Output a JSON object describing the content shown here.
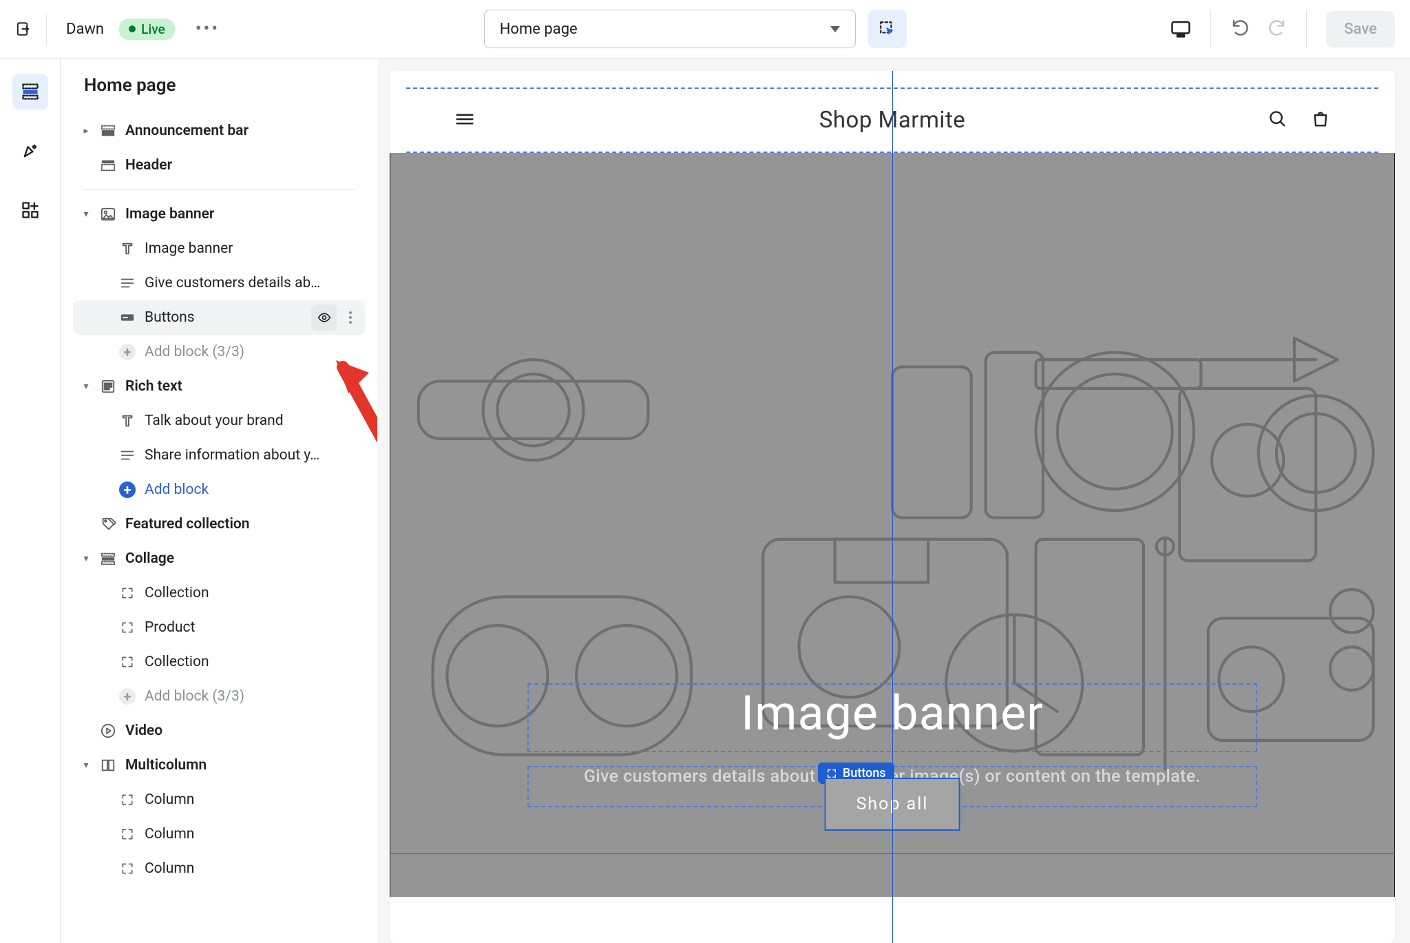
{
  "topbar": {
    "theme_name": "Dawn",
    "status_badge": "Live",
    "page_selector": "Home page",
    "save_label": "Save"
  },
  "tree": {
    "title": "Home page",
    "announcement_bar": "Announcement bar",
    "header": "Header",
    "image_banner": {
      "label": "Image banner",
      "child_heading": "Image banner",
      "child_text": "Give customers details ab…",
      "child_buttons": "Buttons",
      "add_block": "Add block (3/3)"
    },
    "rich_text": {
      "label": "Rich text",
      "child_heading": "Talk about your brand",
      "child_text": "Share information about y…",
      "add_block": "Add block"
    },
    "featured_collection": "Featured collection",
    "collage": {
      "label": "Collage",
      "items": [
        "Collection",
        "Product",
        "Collection"
      ],
      "add_block": "Add block (3/3)"
    },
    "video": "Video",
    "multicolumn": {
      "label": "Multicolumn",
      "items": [
        "Column",
        "Column",
        "Column"
      ]
    }
  },
  "preview": {
    "store_name": "Shop Marmite",
    "banner_heading": "Image banner",
    "banner_sub": "Give customers details about the banner image(s) or content on the template.",
    "selection_label": "Buttons",
    "cta_label": "Shop all"
  }
}
